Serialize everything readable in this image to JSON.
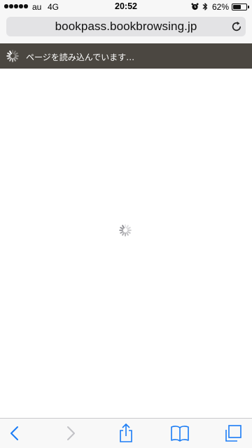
{
  "status_bar": {
    "carrier": "au",
    "network": "4G",
    "time": "20:52",
    "battery_percent": "62%",
    "battery_level": 0.62,
    "icons": [
      "signal-dots",
      "alarm-icon",
      "bluetooth-icon",
      "battery-icon"
    ]
  },
  "browser": {
    "url": "bookpass.bookbrowsing.jp",
    "loading_message": "ページを読み込んでいます…",
    "accent_color": "#1a7cf5",
    "disabled_color": "#c2c2c6",
    "banner_color": "#4b4741"
  },
  "toolbar": {
    "buttons": [
      "back-icon",
      "forward-icon",
      "share-icon",
      "bookmarks-icon",
      "tabs-icon"
    ]
  }
}
